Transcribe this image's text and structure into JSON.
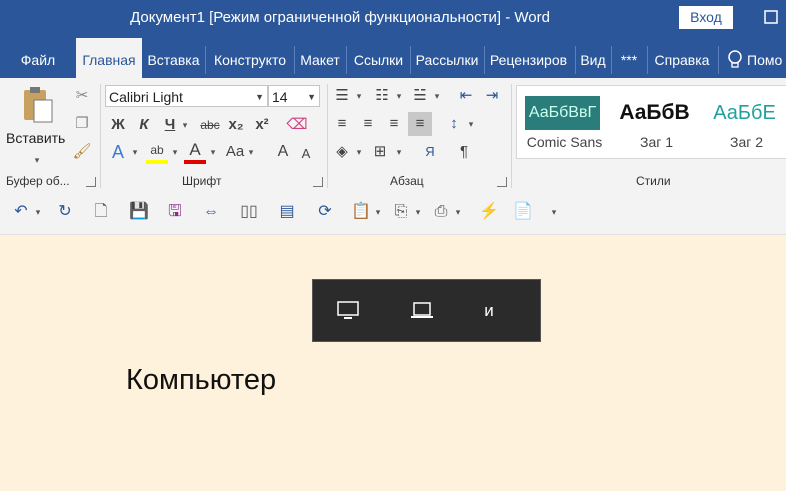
{
  "titlebar": {
    "title": "Документ1 [Режим ограниченной функциональности]  -  Word",
    "login": "Вход",
    "maximize_icon": "maximize-icon"
  },
  "tabs": [
    {
      "label": "Файл",
      "active": false
    },
    {
      "label": "Главная",
      "active": true
    },
    {
      "label": "Вставка",
      "active": false
    },
    {
      "label": "Конструкто",
      "active": false
    },
    {
      "label": "Макет",
      "active": false
    },
    {
      "label": "Ссылки",
      "active": false
    },
    {
      "label": "Рассылки",
      "active": false
    },
    {
      "label": "Рецензиров",
      "active": false
    },
    {
      "label": "Вид",
      "active": false
    },
    {
      "label": "***",
      "active": false
    },
    {
      "label": "Справка",
      "active": false
    },
    {
      "label": "Помо",
      "active": false
    }
  ],
  "clipboard": {
    "paste_label": "Вставить",
    "group_label": "Буфер об..."
  },
  "font": {
    "font_name": "Calibri Light",
    "font_size": "14",
    "bold": "Ж",
    "italic": "К",
    "underline": "Ч",
    "strike": "abc",
    "subscript": "x₂",
    "superscript": "x²",
    "effects": "A",
    "highlight": "ab",
    "font_color": "A",
    "case": "Aa",
    "grow": "A",
    "shrink": "A",
    "group_label": "Шрифт"
  },
  "paragraph": {
    "sort": "Я",
    "pilcrow": "¶",
    "group_label": "Абзац"
  },
  "styles": {
    "items": [
      {
        "preview": "АаБбВвГ",
        "name": "Comic Sans"
      },
      {
        "preview": "АаБбВ",
        "name": "Заг 1"
      },
      {
        "preview": "АаБбЕ",
        "name": "Заг 2"
      }
    ],
    "group_label": "Стили"
  },
  "popup": {
    "letter": "и"
  },
  "document": {
    "text": "Компьютер"
  },
  "colors": {
    "brand": "#2b579a",
    "document_bg": "#fff2dc",
    "highlight_yellow": "#ffff00",
    "font_red": "#e00000",
    "style_teal": "#2a7d7b"
  }
}
